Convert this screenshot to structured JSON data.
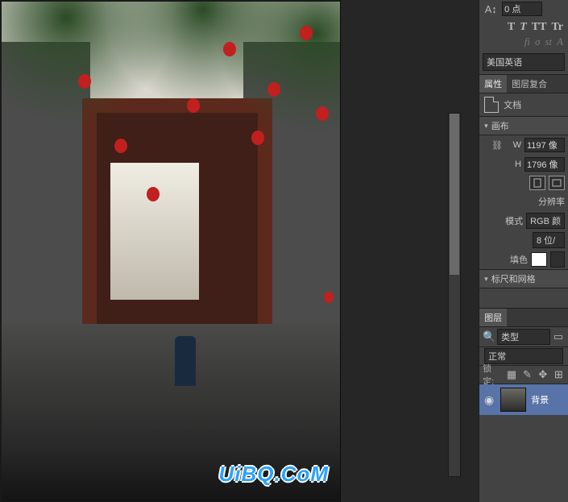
{
  "char_panel": {
    "baseline_icon": "A↕",
    "baseline_value": "0 点",
    "type_buttons": [
      "T",
      "T",
      "TT",
      "Tr"
    ],
    "opentype_buttons": [
      "fi",
      "σ",
      "st",
      "A"
    ],
    "language": "美国英语"
  },
  "tabs": {
    "properties": "属性",
    "layer_comps": "图层复合"
  },
  "properties": {
    "doc_label": "文档",
    "sections": {
      "canvas": "画布",
      "rulers": "标尺和网格"
    },
    "width_label": "W",
    "width_value": "1197 像",
    "height_label": "H",
    "height_value": "1796 像",
    "link_icon": "⛓",
    "resolution_label": "分辨率",
    "mode_label": "模式",
    "mode_value": "RGB 颜",
    "depth_value": "8 位/",
    "fill_label": "填色"
  },
  "layers": {
    "panel_title": "图层",
    "filter_label": "类型",
    "blend_mode": "正常",
    "lock_label": "锁定:",
    "background_name": "背景"
  },
  "watermark": "UiBQ.CoM"
}
